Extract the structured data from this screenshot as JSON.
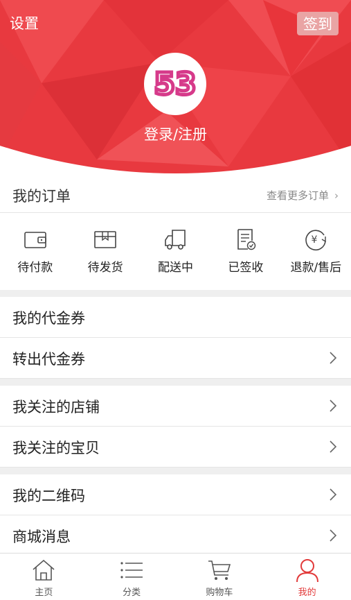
{
  "header": {
    "settings_label": "设置",
    "checkin_label": "签到",
    "logo_text": "53",
    "login_label": "登录/注册",
    "brand_color": "#e8393f",
    "logo_color": "#d63a8a"
  },
  "orders": {
    "title": "我的订单",
    "more_label": "查看更多订单",
    "statuses": [
      {
        "label": "待付款",
        "icon": "wallet-icon"
      },
      {
        "label": "待发货",
        "icon": "package-icon"
      },
      {
        "label": "配送中",
        "icon": "truck-icon"
      },
      {
        "label": "已签收",
        "icon": "signed-document-icon"
      },
      {
        "label": "退款/售后",
        "icon": "yen-refund-icon"
      }
    ]
  },
  "menu": {
    "vouchers": "我的代金券",
    "transfer_vouchers": "转出代金券",
    "followed_shops": "我关注的店铺",
    "followed_items": "我关注的宝贝",
    "qr_code": "我的二维码",
    "mall_messages": "商城消息"
  },
  "tabbar": {
    "items": [
      {
        "label": "主页",
        "icon": "home-icon"
      },
      {
        "label": "分类",
        "icon": "list-icon"
      },
      {
        "label": "购物车",
        "icon": "cart-icon"
      },
      {
        "label": "我的",
        "icon": "user-icon",
        "active": true
      }
    ],
    "active_color": "#e23b3b"
  }
}
